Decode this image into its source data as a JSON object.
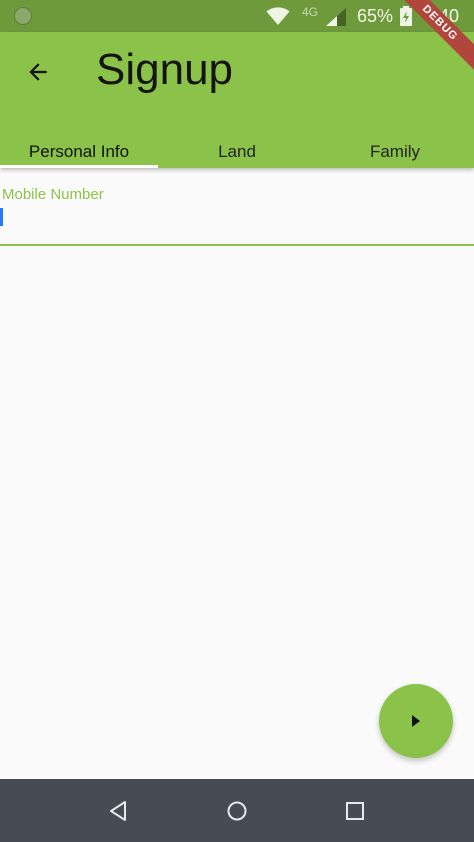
{
  "status_bar": {
    "network": "4G",
    "battery": "65%",
    "time": "0:40"
  },
  "debug_banner": "DEBUG",
  "app_bar": {
    "title": "Signup",
    "back_icon": "arrow-back-icon"
  },
  "tabs": [
    {
      "label": "Personal Info",
      "active": true
    },
    {
      "label": "Land",
      "active": false
    },
    {
      "label": "Family",
      "active": false
    }
  ],
  "form": {
    "mobile_number": {
      "label": "Mobile Number",
      "value": ""
    }
  },
  "fab": {
    "icon": "play-arrow-icon"
  },
  "nav": {
    "back_icon": "nav-back-icon",
    "home_icon": "nav-home-icon",
    "recents_icon": "nav-recents-icon"
  },
  "colors": {
    "primary": "#8bc34a",
    "status_bar": "#6e9a3c",
    "nav_bar": "#454c55",
    "cursor": "#2979ff"
  }
}
